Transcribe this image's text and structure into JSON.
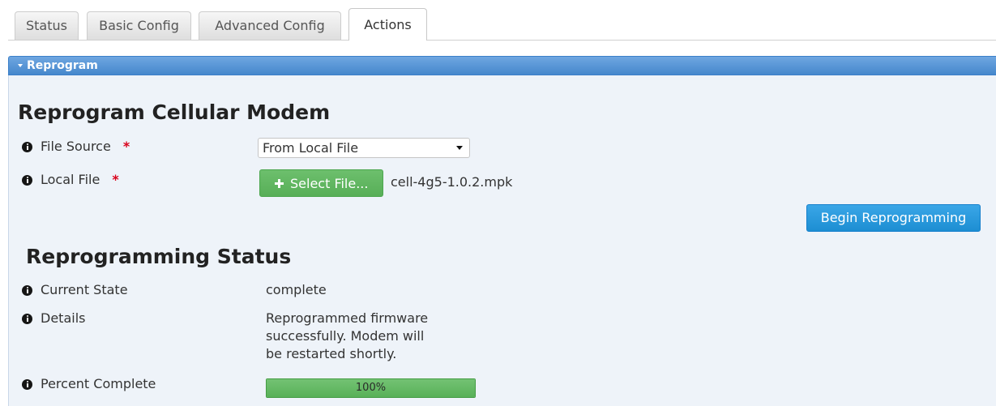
{
  "tabs": [
    {
      "label": "Status",
      "active": false
    },
    {
      "label": "Basic Config",
      "active": false
    },
    {
      "label": "Advanced Config",
      "active": false
    },
    {
      "label": "Actions",
      "active": true
    }
  ],
  "panel": {
    "title": "Reprogram",
    "toggle_icon": "caret-down-icon"
  },
  "reprogram": {
    "heading": "Reprogram Cellular Modem",
    "file_source": {
      "icon": "info-icon",
      "label": "File Source",
      "required_mark": "*",
      "value": "From Local File",
      "dropdown_icon": "chevron-down-icon"
    },
    "local_file": {
      "icon": "info-icon",
      "label": "Local File",
      "required_mark": "*",
      "button_icon": "plus-icon",
      "button_label": "Select File...",
      "file_name": "cell-4g5-1.0.2.mpk"
    },
    "begin_button": "Begin Reprogramming"
  },
  "status": {
    "heading": "Reprogramming Status",
    "current_state": {
      "icon": "info-icon",
      "label": "Current State",
      "value": "complete"
    },
    "details": {
      "icon": "info-icon",
      "label": "Details",
      "value": "Reprogrammed firmware successfully. Modem will be restarted shortly."
    },
    "percent_complete": {
      "icon": "info-icon",
      "label": "Percent Complete",
      "value": 100,
      "text": "100%"
    }
  },
  "colors": {
    "panel_header": "#4a90d9",
    "panel_body": "#eef3f9",
    "required": "#d9001b",
    "success": "#5cb85c",
    "primary": "#1f9ae4"
  }
}
